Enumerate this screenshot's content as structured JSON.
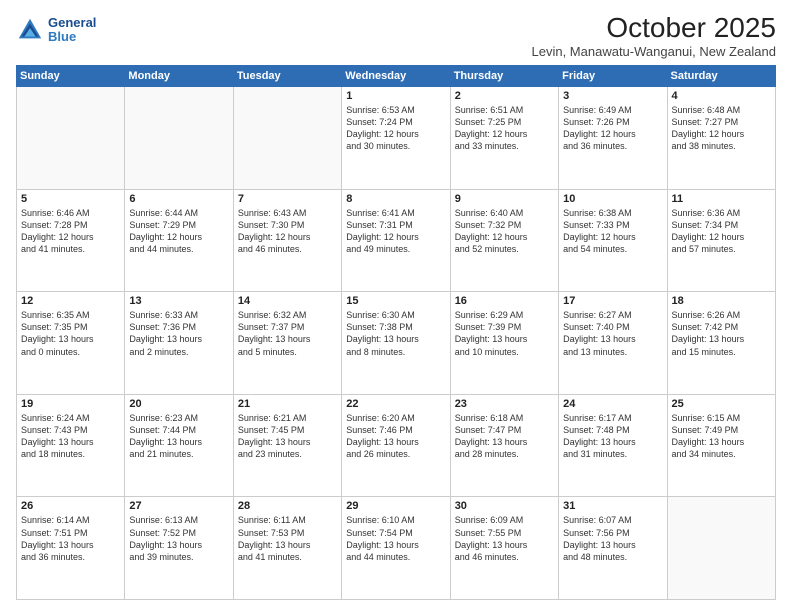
{
  "header": {
    "logo_line1": "General",
    "logo_line2": "Blue",
    "month": "October 2025",
    "location": "Levin, Manawatu-Wanganui, New Zealand"
  },
  "weekdays": [
    "Sunday",
    "Monday",
    "Tuesday",
    "Wednesday",
    "Thursday",
    "Friday",
    "Saturday"
  ],
  "weeks": [
    [
      {
        "day": "",
        "text": ""
      },
      {
        "day": "",
        "text": ""
      },
      {
        "day": "",
        "text": ""
      },
      {
        "day": "1",
        "text": "Sunrise: 6:53 AM\nSunset: 7:24 PM\nDaylight: 12 hours\nand 30 minutes."
      },
      {
        "day": "2",
        "text": "Sunrise: 6:51 AM\nSunset: 7:25 PM\nDaylight: 12 hours\nand 33 minutes."
      },
      {
        "day": "3",
        "text": "Sunrise: 6:49 AM\nSunset: 7:26 PM\nDaylight: 12 hours\nand 36 minutes."
      },
      {
        "day": "4",
        "text": "Sunrise: 6:48 AM\nSunset: 7:27 PM\nDaylight: 12 hours\nand 38 minutes."
      }
    ],
    [
      {
        "day": "5",
        "text": "Sunrise: 6:46 AM\nSunset: 7:28 PM\nDaylight: 12 hours\nand 41 minutes."
      },
      {
        "day": "6",
        "text": "Sunrise: 6:44 AM\nSunset: 7:29 PM\nDaylight: 12 hours\nand 44 minutes."
      },
      {
        "day": "7",
        "text": "Sunrise: 6:43 AM\nSunset: 7:30 PM\nDaylight: 12 hours\nand 46 minutes."
      },
      {
        "day": "8",
        "text": "Sunrise: 6:41 AM\nSunset: 7:31 PM\nDaylight: 12 hours\nand 49 minutes."
      },
      {
        "day": "9",
        "text": "Sunrise: 6:40 AM\nSunset: 7:32 PM\nDaylight: 12 hours\nand 52 minutes."
      },
      {
        "day": "10",
        "text": "Sunrise: 6:38 AM\nSunset: 7:33 PM\nDaylight: 12 hours\nand 54 minutes."
      },
      {
        "day": "11",
        "text": "Sunrise: 6:36 AM\nSunset: 7:34 PM\nDaylight: 12 hours\nand 57 minutes."
      }
    ],
    [
      {
        "day": "12",
        "text": "Sunrise: 6:35 AM\nSunset: 7:35 PM\nDaylight: 13 hours\nand 0 minutes."
      },
      {
        "day": "13",
        "text": "Sunrise: 6:33 AM\nSunset: 7:36 PM\nDaylight: 13 hours\nand 2 minutes."
      },
      {
        "day": "14",
        "text": "Sunrise: 6:32 AM\nSunset: 7:37 PM\nDaylight: 13 hours\nand 5 minutes."
      },
      {
        "day": "15",
        "text": "Sunrise: 6:30 AM\nSunset: 7:38 PM\nDaylight: 13 hours\nand 8 minutes."
      },
      {
        "day": "16",
        "text": "Sunrise: 6:29 AM\nSunset: 7:39 PM\nDaylight: 13 hours\nand 10 minutes."
      },
      {
        "day": "17",
        "text": "Sunrise: 6:27 AM\nSunset: 7:40 PM\nDaylight: 13 hours\nand 13 minutes."
      },
      {
        "day": "18",
        "text": "Sunrise: 6:26 AM\nSunset: 7:42 PM\nDaylight: 13 hours\nand 15 minutes."
      }
    ],
    [
      {
        "day": "19",
        "text": "Sunrise: 6:24 AM\nSunset: 7:43 PM\nDaylight: 13 hours\nand 18 minutes."
      },
      {
        "day": "20",
        "text": "Sunrise: 6:23 AM\nSunset: 7:44 PM\nDaylight: 13 hours\nand 21 minutes."
      },
      {
        "day": "21",
        "text": "Sunrise: 6:21 AM\nSunset: 7:45 PM\nDaylight: 13 hours\nand 23 minutes."
      },
      {
        "day": "22",
        "text": "Sunrise: 6:20 AM\nSunset: 7:46 PM\nDaylight: 13 hours\nand 26 minutes."
      },
      {
        "day": "23",
        "text": "Sunrise: 6:18 AM\nSunset: 7:47 PM\nDaylight: 13 hours\nand 28 minutes."
      },
      {
        "day": "24",
        "text": "Sunrise: 6:17 AM\nSunset: 7:48 PM\nDaylight: 13 hours\nand 31 minutes."
      },
      {
        "day": "25",
        "text": "Sunrise: 6:15 AM\nSunset: 7:49 PM\nDaylight: 13 hours\nand 34 minutes."
      }
    ],
    [
      {
        "day": "26",
        "text": "Sunrise: 6:14 AM\nSunset: 7:51 PM\nDaylight: 13 hours\nand 36 minutes."
      },
      {
        "day": "27",
        "text": "Sunrise: 6:13 AM\nSunset: 7:52 PM\nDaylight: 13 hours\nand 39 minutes."
      },
      {
        "day": "28",
        "text": "Sunrise: 6:11 AM\nSunset: 7:53 PM\nDaylight: 13 hours\nand 41 minutes."
      },
      {
        "day": "29",
        "text": "Sunrise: 6:10 AM\nSunset: 7:54 PM\nDaylight: 13 hours\nand 44 minutes."
      },
      {
        "day": "30",
        "text": "Sunrise: 6:09 AM\nSunset: 7:55 PM\nDaylight: 13 hours\nand 46 minutes."
      },
      {
        "day": "31",
        "text": "Sunrise: 6:07 AM\nSunset: 7:56 PM\nDaylight: 13 hours\nand 48 minutes."
      },
      {
        "day": "",
        "text": ""
      }
    ]
  ]
}
